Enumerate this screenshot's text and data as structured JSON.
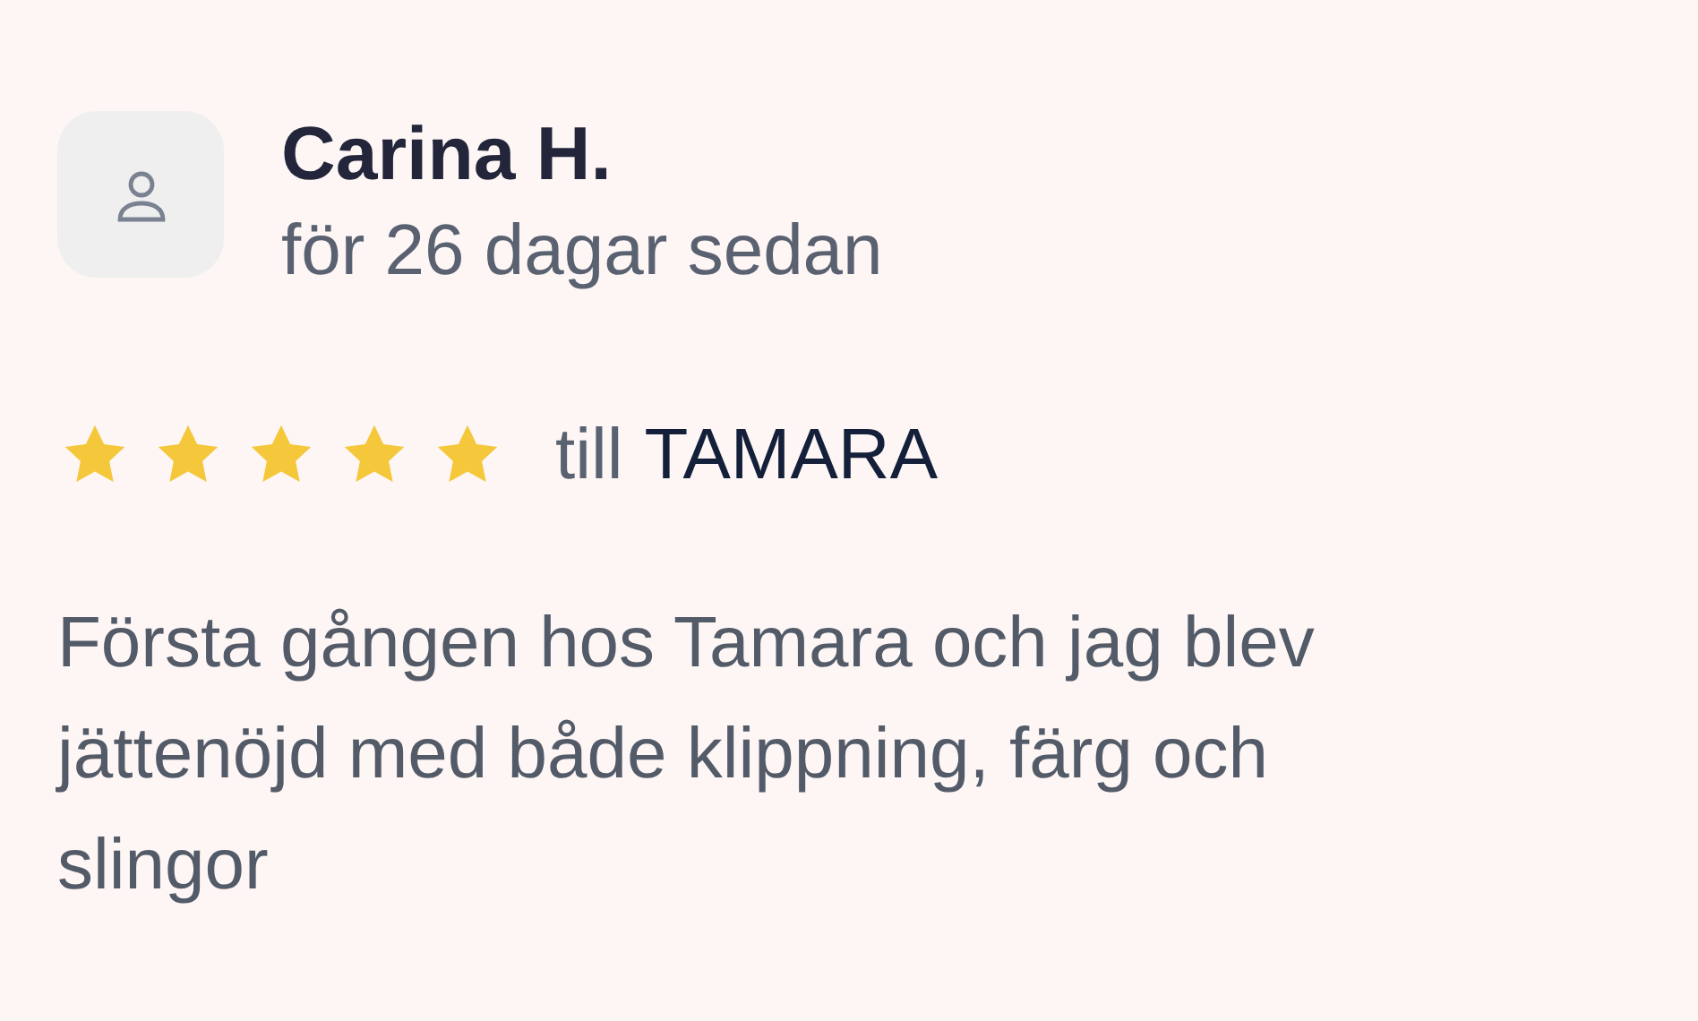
{
  "review": {
    "author": "Carina H.",
    "time": "för 26 dagar sedan",
    "stars": 5,
    "to_label": "till",
    "to_name": "TAMARA",
    "text": "Första gången hos Tamara och jag blev jättenöjd med både klippning, färg och slingor"
  }
}
